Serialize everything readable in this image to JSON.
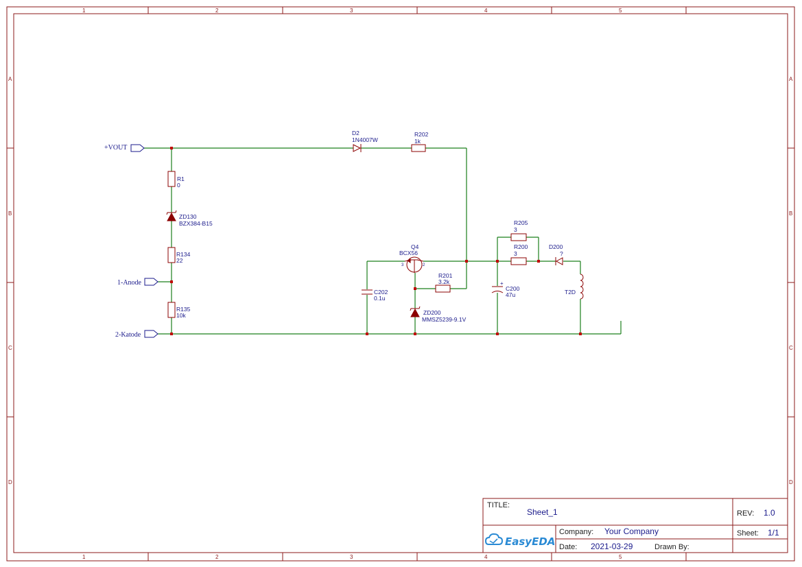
{
  "grid": {
    "columns": [
      "1",
      "2",
      "3",
      "4",
      "5"
    ],
    "rows": [
      "A",
      "B",
      "C",
      "D"
    ]
  },
  "ports": [
    {
      "id": "vout",
      "label": "+VOUT"
    },
    {
      "id": "anode",
      "label": "1-Anode"
    },
    {
      "id": "katode",
      "label": "2-Katode"
    }
  ],
  "components": {
    "D2": {
      "ref": "D2",
      "value": "1N4007W"
    },
    "R202": {
      "ref": "R202",
      "value": "1k"
    },
    "R1": {
      "ref": "R1",
      "value": "0"
    },
    "ZD130": {
      "ref": "ZD130",
      "value": "BZX384-B15"
    },
    "R134": {
      "ref": "R134",
      "value": "22"
    },
    "R135": {
      "ref": "R135",
      "value": "10k"
    },
    "Q4": {
      "ref": "Q4",
      "value": "BCX56",
      "pin3": "3",
      "pin2": "2"
    },
    "C202": {
      "ref": "C202",
      "value": "0.1u"
    },
    "R201": {
      "ref": "R201",
      "value": "3.2k"
    },
    "ZD200": {
      "ref": "ZD200",
      "value": "MMSZ5239-9.1V"
    },
    "R205": {
      "ref": "R205",
      "value": "3"
    },
    "R200": {
      "ref": "R200",
      "value": "3"
    },
    "D200": {
      "ref": "D200",
      "value": "?"
    },
    "C200": {
      "ref": "C200",
      "value": "47u"
    },
    "T2D": {
      "ref": "T2D"
    }
  },
  "title_block": {
    "title_label": "TITLE:",
    "title": "Sheet_1",
    "rev_label": "REV:",
    "rev": "1.0",
    "company_label": "Company:",
    "company": "Your Company",
    "sheet_label": "Sheet:",
    "sheet": "1/1",
    "date_label": "Date:",
    "date": "2021-03-29",
    "drawn_label": "Drawn By:",
    "drawn": "",
    "logo_text": "EasyEDA"
  },
  "colors": {
    "frame": "#8b1a1a",
    "wire": "#1a7f1a",
    "component": "#8b0000",
    "text": "#1a1a8b",
    "logo": "#2a8ad4"
  }
}
